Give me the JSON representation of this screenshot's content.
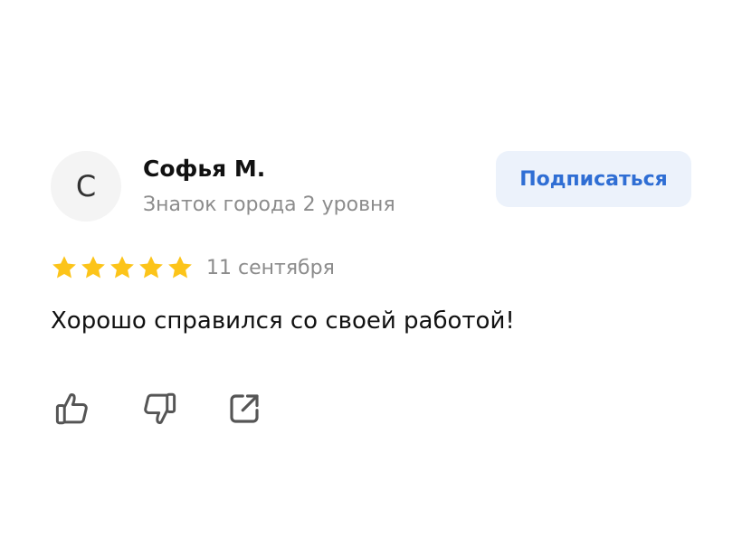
{
  "review": {
    "author": {
      "initial": "С",
      "name": "Софья М.",
      "level": "Знаток города 2 уровня"
    },
    "subscribe_label": "Подписаться",
    "rating": 5,
    "rating_max": 5,
    "date": "11 сентября",
    "text": "Хорошо справился со своей работой!",
    "actions": [
      "thumbs-up-icon",
      "thumbs-down-icon",
      "share-icon"
    ]
  },
  "colors": {
    "star": "#fcc419",
    "accent": "#2f6ed4",
    "button_bg": "#ecf2fb",
    "muted_text": "#8c8c8c",
    "icon": "#555555"
  }
}
